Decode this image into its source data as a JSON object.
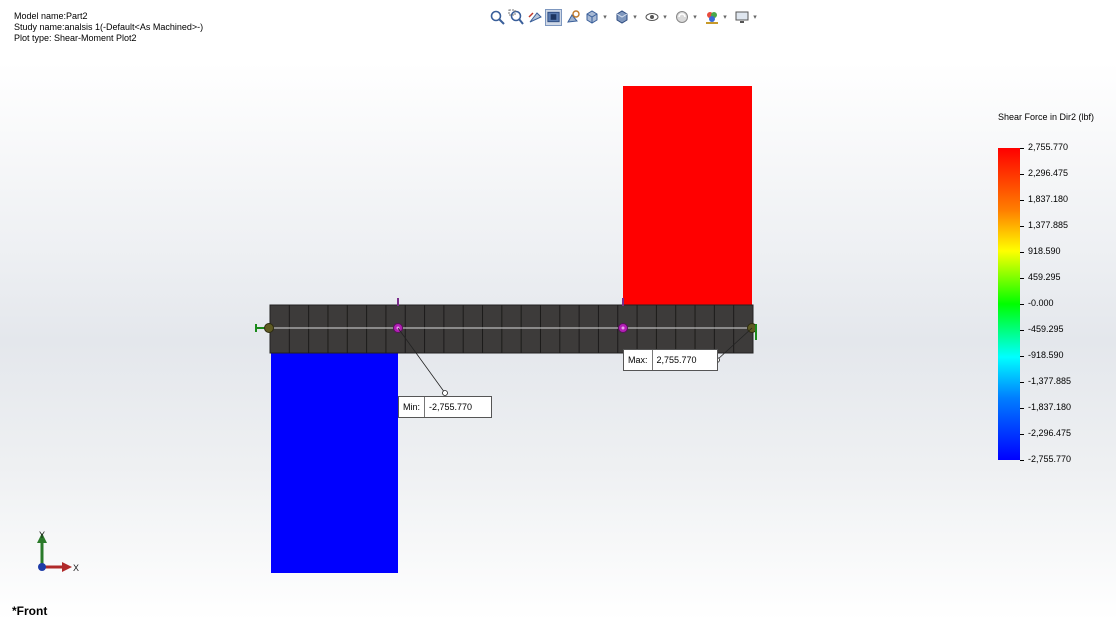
{
  "info": {
    "model": "Model name:Part2",
    "study": "Study name:analsis 1(-Default<As Machined>-)",
    "plot_type": "Plot type:  Shear-Moment Plot2"
  },
  "toolbar": [
    {
      "icon": "zoom-to-fit-icon"
    },
    {
      "icon": "zoom-to-area-icon"
    },
    {
      "icon": "previous-view-icon"
    },
    {
      "icon": "section-view-icon",
      "active": true
    },
    {
      "icon": "dynamic-annotation-icon"
    },
    {
      "icon": "view-orientation-icon",
      "dropdown": true
    },
    {
      "icon": "display-style-icon",
      "dropdown": true
    },
    {
      "icon": "hide-show-items-icon",
      "dropdown": true
    },
    {
      "icon": "edit-appearance-icon",
      "dropdown": true
    },
    {
      "icon": "apply-scene-icon",
      "dropdown": true
    },
    {
      "icon": "view-settings-icon",
      "dropdown": true
    }
  ],
  "legend": {
    "title": "Shear Force in Dir2 (lbf)",
    "ticks": [
      "2,755.770",
      "2,296.475",
      "1,837.180",
      "1,377.885",
      "918.590",
      "459.295",
      "-0.000",
      "-459.295",
      "-918.590",
      "-1,377.885",
      "-1,837.180",
      "-2,296.475",
      "-2,755.770"
    ],
    "colors": {
      "max": "#ff0000",
      "min": "#0000ff"
    }
  },
  "chart_data": {
    "type": "bar",
    "title": "Shear Force in Dir2 (lbf)",
    "x": [
      "left support",
      "first load point",
      "second load point",
      "right support"
    ],
    "segments": [
      {
        "from": "left support",
        "to": "first load point",
        "value": -2755.77
      },
      {
        "from": "first load point",
        "to": "second load point",
        "value": 0
      },
      {
        "from": "second load point",
        "to": "right support",
        "value": 2755.77
      }
    ],
    "ylim": [
      -2755.77,
      2755.77
    ]
  },
  "callouts": {
    "min": {
      "label": "Min:",
      "value": "-2,755.770"
    },
    "max": {
      "label": "Max:",
      "value": "2,755.770"
    }
  },
  "triad": {
    "y": "Y",
    "x": "X"
  },
  "view_label": "*Front"
}
